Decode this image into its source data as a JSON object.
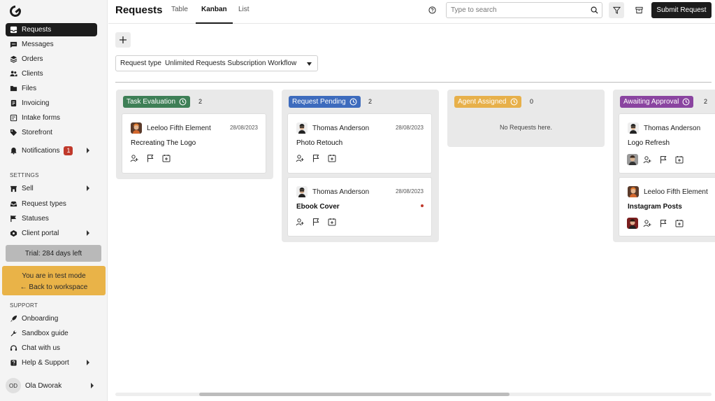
{
  "sidebar": {
    "nav": [
      {
        "label": "Requests",
        "icon": "inbox-icon"
      },
      {
        "label": "Messages",
        "icon": "chat-icon"
      },
      {
        "label": "Orders",
        "icon": "layers-icon"
      },
      {
        "label": "Clients",
        "icon": "users-icon"
      },
      {
        "label": "Files",
        "icon": "folder-icon"
      },
      {
        "label": "Invoicing",
        "icon": "invoice-icon"
      },
      {
        "label": "Intake forms",
        "icon": "form-icon"
      },
      {
        "label": "Storefront",
        "icon": "tag-icon"
      }
    ],
    "notifications": {
      "label": "Notifications",
      "count": "1",
      "icon": "bell-icon"
    },
    "settings_heading": "SETTINGS",
    "settings": [
      {
        "label": "Sell",
        "icon": "store-icon"
      },
      {
        "label": "Request types",
        "icon": "tray-icon"
      },
      {
        "label": "Statuses",
        "icon": "flag-icon"
      },
      {
        "label": "Client portal",
        "icon": "portal-icon"
      }
    ],
    "trial": "Trial: 284 days left",
    "test_mode": {
      "line1": "You are in test mode",
      "line2": "← Back to workspace"
    },
    "support_heading": "SUPPORT",
    "support": [
      {
        "label": "Onboarding",
        "icon": "rocket-icon"
      },
      {
        "label": "Sandbox guide",
        "icon": "wrench-icon"
      },
      {
        "label": "Chat with us",
        "icon": "headset-icon"
      },
      {
        "label": "Help & Support",
        "icon": "help-book-icon"
      }
    ],
    "user": {
      "initials": "OD",
      "name": "Ola Dworak"
    }
  },
  "header": {
    "title": "Requests",
    "tabs": [
      "Table",
      "Kanban",
      "List"
    ],
    "active_tab": "Kanban",
    "search_placeholder": "Type to search",
    "submit_label": "Submit Request"
  },
  "filter": {
    "label": "Request type",
    "value": "Unlimited Requests Subscription Workflow"
  },
  "colors": {
    "task_evaluation": "#3e7f56",
    "request_pending": "#3d6bbd",
    "agent_assigned": "#e7b04a",
    "awaiting_approval": "#8a44a0",
    "primary": "#1c1c1c"
  },
  "columns": [
    {
      "status": "Task Evaluation",
      "count": "2",
      "cards": [
        {
          "user": "Leeloo Fifth Element",
          "date": "28/08/2023",
          "title": "Recreating The Logo"
        }
      ]
    },
    {
      "status": "Request Pending",
      "count": "2",
      "cards": [
        {
          "user": "Thomas Anderson",
          "date": "28/08/2023",
          "title": "Photo Retouch"
        },
        {
          "user": "Thomas Anderson",
          "date": "28/08/2023",
          "title": "Ebook Cover"
        }
      ]
    },
    {
      "status": "Agent Assigned",
      "count": "0",
      "empty": "No Requests here."
    },
    {
      "status": "Awaiting Approval",
      "count": "2",
      "cards": [
        {
          "user": "Thomas Anderson",
          "title": "Logo Refresh"
        },
        {
          "user": "Leeloo Fifth Element",
          "title": "Instagram Posts"
        }
      ]
    }
  ]
}
